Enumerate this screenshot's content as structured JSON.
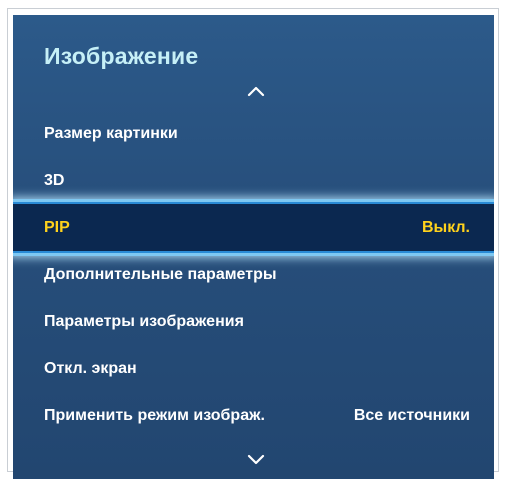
{
  "menu": {
    "title": "Изображение",
    "items": [
      {
        "label": "Размер картинки",
        "value": ""
      },
      {
        "label": "3D",
        "value": ""
      },
      {
        "label": "PIP",
        "value": "Выкл.",
        "selected": true
      },
      {
        "label": "Дополнительные параметры",
        "value": ""
      },
      {
        "label": "Параметры изображения",
        "value": ""
      },
      {
        "label": "Откл. экран",
        "value": ""
      },
      {
        "label": "Применить режим изображ.",
        "value": "Все источники"
      }
    ]
  },
  "icons": {
    "scroll_up": "chevron-up-icon",
    "scroll_down": "chevron-down-icon"
  },
  "colors": {
    "panel_background": "#2a5585",
    "title": "#c6f0f7",
    "selected_background": "#0b2850",
    "selected_text": "#ffd21c",
    "selected_glow": "#7fc8f2"
  }
}
